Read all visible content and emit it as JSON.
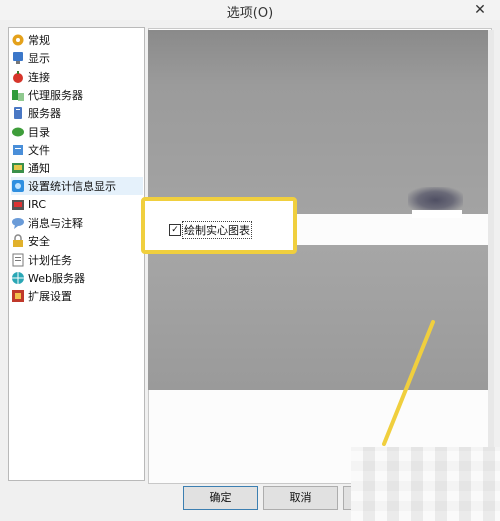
{
  "window": {
    "title": "选项(O)",
    "close_glyph": "✕"
  },
  "tree": {
    "items": [
      {
        "label": "常规",
        "icon": "gear-icon",
        "color": "#e4a11b",
        "selected": false
      },
      {
        "label": "显示",
        "icon": "display-icon",
        "color": "#3b77c9",
        "selected": false
      },
      {
        "label": "连接",
        "icon": "connection-icon",
        "color": "#d6352b",
        "selected": false
      },
      {
        "label": "代理服务器",
        "icon": "proxy-icon",
        "color": "#2e9b3a",
        "selected": false
      },
      {
        "label": "服务器",
        "icon": "server-icon",
        "color": "#4a78c4",
        "selected": false
      },
      {
        "label": "目录",
        "icon": "directory-icon",
        "color": "#3e9d3a",
        "selected": false
      },
      {
        "label": "文件",
        "icon": "file-icon",
        "color": "#4a8fd9",
        "selected": false
      },
      {
        "label": "通知",
        "icon": "notify-icon",
        "color": "#3a8f4a",
        "selected": false
      },
      {
        "label": "设置统计信息显示",
        "icon": "stats-icon",
        "color": "#2f8fe0",
        "selected": true
      },
      {
        "label": "IRC",
        "icon": "irc-icon",
        "color": "#555555",
        "selected": false
      },
      {
        "label": "消息与注释",
        "icon": "message-icon",
        "color": "#6a9bd8",
        "selected": false
      },
      {
        "label": "安全",
        "icon": "lock-icon",
        "color": "#e1b12c",
        "selected": false
      },
      {
        "label": "计划任务",
        "icon": "schedule-icon",
        "color": "#7a7a7a",
        "selected": false
      },
      {
        "label": "Web服务器",
        "icon": "web-icon",
        "color": "#2aa7b5",
        "selected": false
      },
      {
        "label": "扩展设置",
        "icon": "extension-icon",
        "color": "#c0392b",
        "selected": false
      }
    ]
  },
  "content": {
    "checkbox": {
      "label": "绘制实心图表",
      "checked": true,
      "check_glyph": "✓"
    }
  },
  "buttons": {
    "ok": "确定",
    "cancel": "取消",
    "third": ""
  },
  "colors": {
    "highlight": "#f0cf3e",
    "selected_row": "#e5f1fb"
  }
}
